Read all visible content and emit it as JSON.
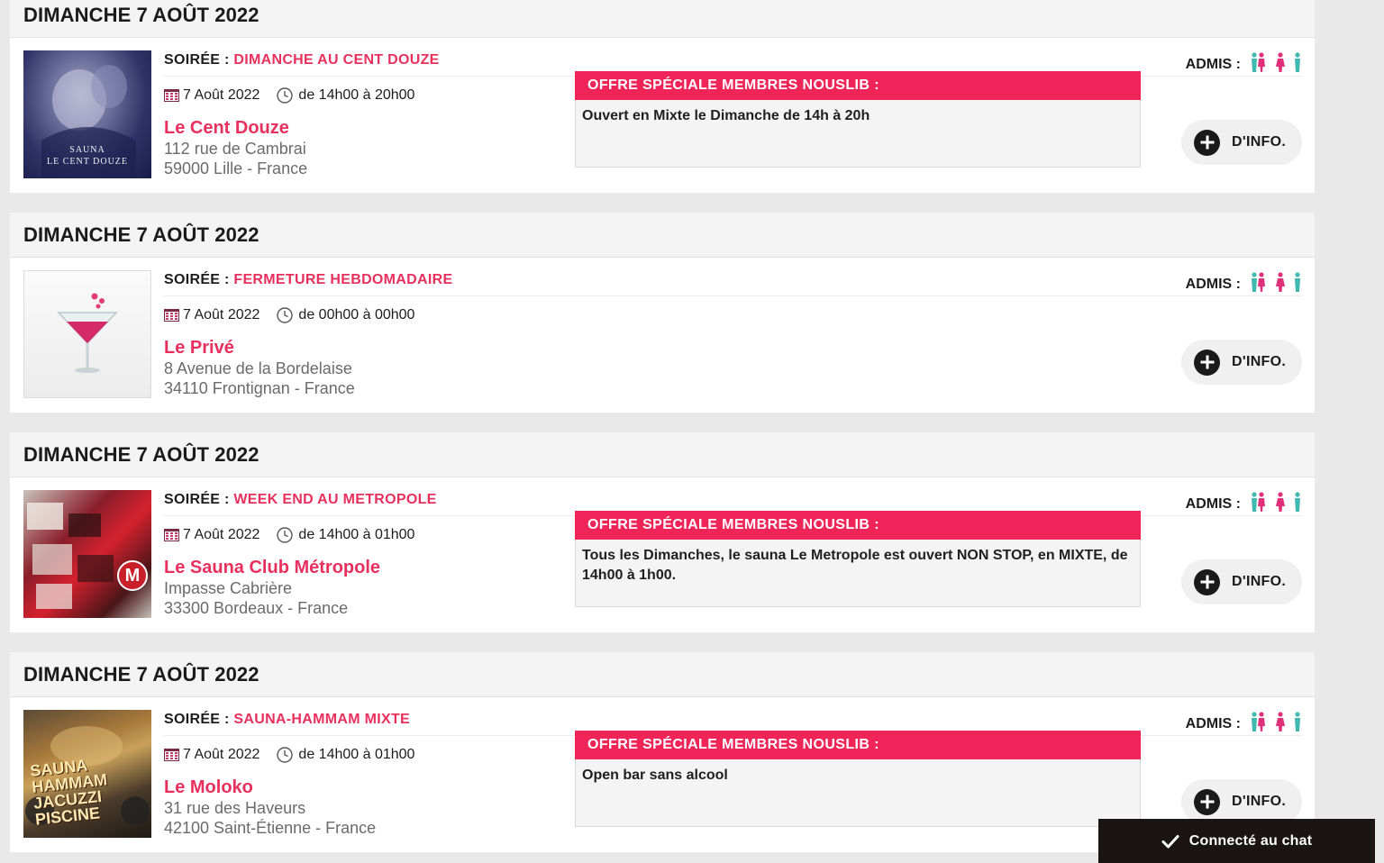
{
  "colors": {
    "accent_pink": "#ef2559",
    "venue_pink": "#e8305f",
    "admis_teal": "#3fb8b0",
    "admis_pink": "#e02f7b",
    "chat_bar_bg": "#1a1414"
  },
  "events": [
    {
      "date_header": "DIMANCHE 7 AOÛT 2022",
      "soiree_key": "SOIRÉE :",
      "soiree_name": "DIMANCHE AU CENT DOUZE",
      "date": "7 Août 2022",
      "hours": "de 14h00 à 20h00",
      "venue": "Le Cent Douze",
      "address_line1": "112 rue de Cambrai",
      "address_line2": "59000 Lille - France",
      "thumb_caption_1": "SAUNA",
      "thumb_caption_2": "LE CENT DOUZE",
      "offer_title": "OFFRE SPÉCIALE MEMBRES NOUSLIB :",
      "offer_text": "Ouvert en Mixte le Dimanche de 14h à 20h",
      "admis_label": "ADMIS :",
      "info_label": "D'INFO."
    },
    {
      "date_header": "DIMANCHE 7 AOÛT 2022",
      "soiree_key": "SOIRÉE :",
      "soiree_name": "FERMETURE HEBDOMADAIRE",
      "date": "7 Août 2022",
      "hours": "de 00h00 à 00h00",
      "venue": "Le Privé",
      "address_line1": "8 Avenue de la Bordelaise",
      "address_line2": "34110 Frontignan - France",
      "admis_label": "ADMIS :",
      "info_label": "D'INFO."
    },
    {
      "date_header": "DIMANCHE 7 AOÛT 2022",
      "soiree_key": "SOIRÉE :",
      "soiree_name": "WEEK END AU METROPOLE",
      "date": "7 Août 2022",
      "hours": "de 14h00 à 01h00",
      "venue": "Le Sauna Club Métropole",
      "address_line1": "Impasse Cabrière",
      "address_line2": "33300 Bordeaux - France",
      "thumb_badge": "M",
      "offer_title": "OFFRE SPÉCIALE MEMBRES NOUSLIB :",
      "offer_text": "Tous les Dimanches, le sauna Le Metropole est ouvert NON STOP, en MIXTE, de 14h00 à 1h00.",
      "admis_label": "ADMIS :",
      "info_label": "D'INFO."
    },
    {
      "date_header": "DIMANCHE 7 AOÛT 2022",
      "soiree_key": "SOIRÉE :",
      "soiree_name": "SAUNA-HAMMAM MIXTE",
      "date": "7 Août 2022",
      "hours": "de 14h00 à 01h00",
      "venue": "Le Moloko",
      "address_line1": "31 rue des Haveurs",
      "address_line2": "42100 Saint-Étienne - France",
      "thumb_caption_1": "SAUNA HAMMAM",
      "thumb_caption_2": "JACUZZI PISCINE",
      "offer_title": "OFFRE SPÉCIALE MEMBRES NOUSLIB :",
      "offer_text": "Open bar sans alcool",
      "admis_label": "ADMIS :",
      "info_label": "D'INFO."
    }
  ],
  "chat": {
    "label": "Connecté au chat",
    "icon": "check-icon"
  }
}
